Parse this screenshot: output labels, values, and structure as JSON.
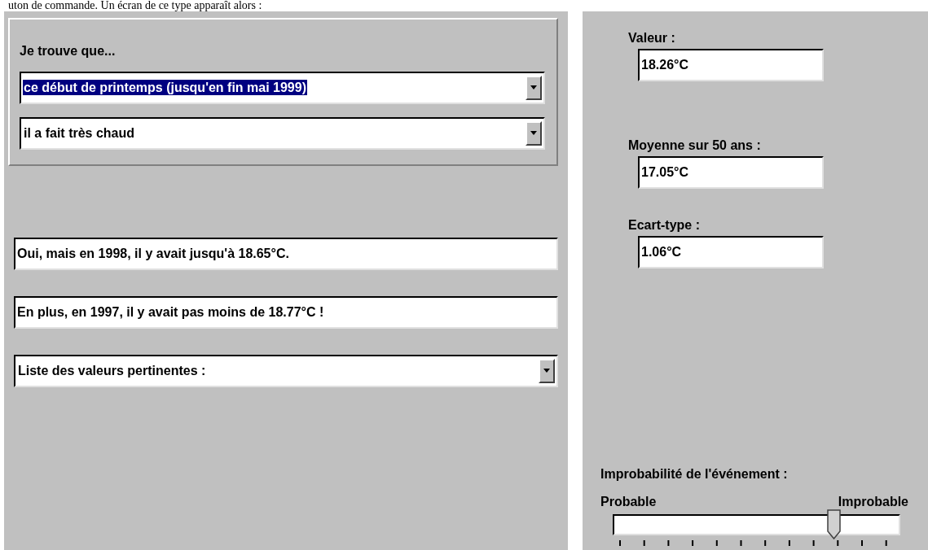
{
  "caption": "uton de commande. Un écran de ce type apparaît alors :",
  "query_group": {
    "label": "Je trouve que...",
    "combos": [
      {
        "value": "ce début de printemps (jusqu'en fin mai 1999)",
        "selected": true
      },
      {
        "value": "il a fait très chaud",
        "selected": false
      }
    ]
  },
  "answers": [
    {
      "kind": "text",
      "value": "Oui, mais en 1998, il y avait jusqu'à 18.65°C."
    },
    {
      "kind": "text",
      "value": "En plus, en 1997, il y avait pas moins de 18.77°C !"
    },
    {
      "kind": "combo",
      "value": "Liste des valeurs pertinentes :"
    }
  ],
  "stats": [
    {
      "label": "Valeur :",
      "value": "18.26°C"
    },
    {
      "label": "Moyenne sur 50 ans :",
      "value": "17.05°C"
    },
    {
      "label": "Ecart-type :",
      "value": "1.06°C"
    }
  ],
  "improbability": {
    "label": "Improbabilité de l'événement :",
    "min_label": "Probable",
    "max_label": "Improbable",
    "level": 0.77
  }
}
